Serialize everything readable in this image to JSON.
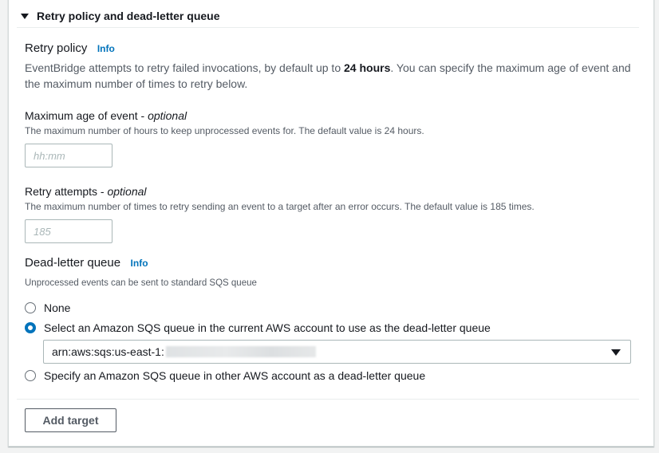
{
  "section": {
    "title": "Retry policy and dead-letter queue",
    "expanded": true
  },
  "retry_policy": {
    "heading": "Retry policy",
    "info_label": "Info",
    "description_prefix": "EventBridge attempts to retry failed invocations, by default up to ",
    "description_bold": "24 hours",
    "description_suffix": ". You can specify the maximum age of event and the maximum number of times to retry below."
  },
  "max_age": {
    "label": "Maximum age of event - ",
    "label_optional": "optional",
    "hint": "The maximum number of hours to keep unprocessed events for. The default value is 24 hours.",
    "placeholder": "hh:mm",
    "value": ""
  },
  "retry_attempts": {
    "label": "Retry attempts - ",
    "label_optional": "optional",
    "hint": "The maximum number of times to retry sending an event to a target after an error occurs. The default value is 185 times.",
    "placeholder": "185",
    "value": ""
  },
  "dlq": {
    "heading": "Dead-letter queue",
    "info_label": "Info",
    "hint": "Unprocessed events can be sent to standard SQS queue",
    "options": [
      {
        "label": "None",
        "selected": false
      },
      {
        "label": "Select an Amazon SQS queue in the current AWS account to use as the dead-letter queue",
        "selected": true
      },
      {
        "label": "Specify an Amazon SQS queue in other AWS account as a dead-letter queue",
        "selected": false
      }
    ],
    "queue_select_value": "arn:aws:sqs:us-east-1:"
  },
  "footer": {
    "add_target_label": "Add target"
  },
  "colors": {
    "link": "#0073bb",
    "radio_selected": "#0073bb",
    "text": "#16191f",
    "secondary_text": "#545b64"
  }
}
